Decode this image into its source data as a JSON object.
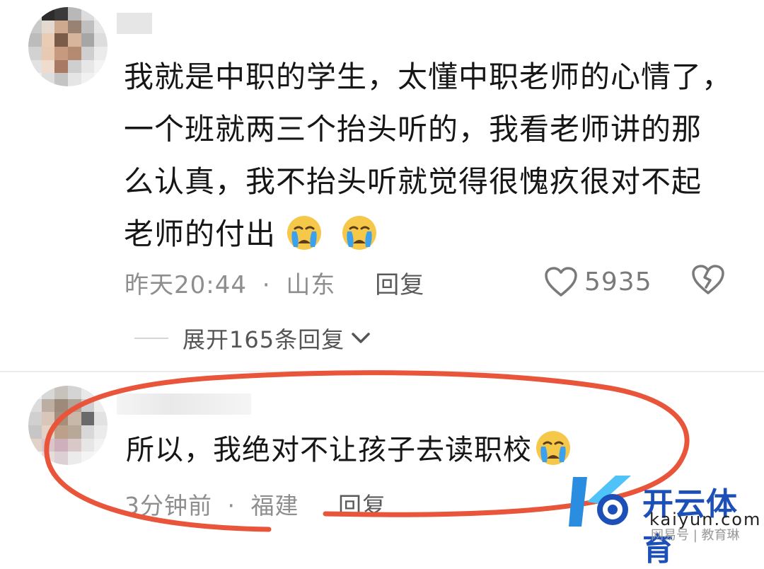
{
  "comment1": {
    "lines": [
      "我就是中职的学生，太懂中职老师的心情了，",
      "一个班就两三个抬头听的，我看老师讲的那",
      "么认真，我不抬头听就觉得很愧疚很对不起",
      "老师的付出"
    ],
    "emojis": [
      "crying-face",
      "crying-face"
    ],
    "time": "昨天20:44",
    "separator": "·",
    "location": "山东",
    "reply_label": "回复",
    "like_count": "5935",
    "expand_label": "展开165条回复"
  },
  "comment2": {
    "text": "所以，我绝对不让孩子去读职校",
    "emoji": "crying-face",
    "time": "3分钟前",
    "separator": "·",
    "location": "福建",
    "reply_label": "回复"
  },
  "watermark": {
    "brand": "开云体育",
    "url": "kaiyun.com",
    "sub": "网易号 | 教育琳"
  },
  "colors": {
    "annotation_circle": "#e8553a",
    "meta_text": "#8e8e8e",
    "emoji_face": "#f6c84a",
    "tear": "#3aa0f0",
    "watermark_blue": "#1c4fb8"
  }
}
